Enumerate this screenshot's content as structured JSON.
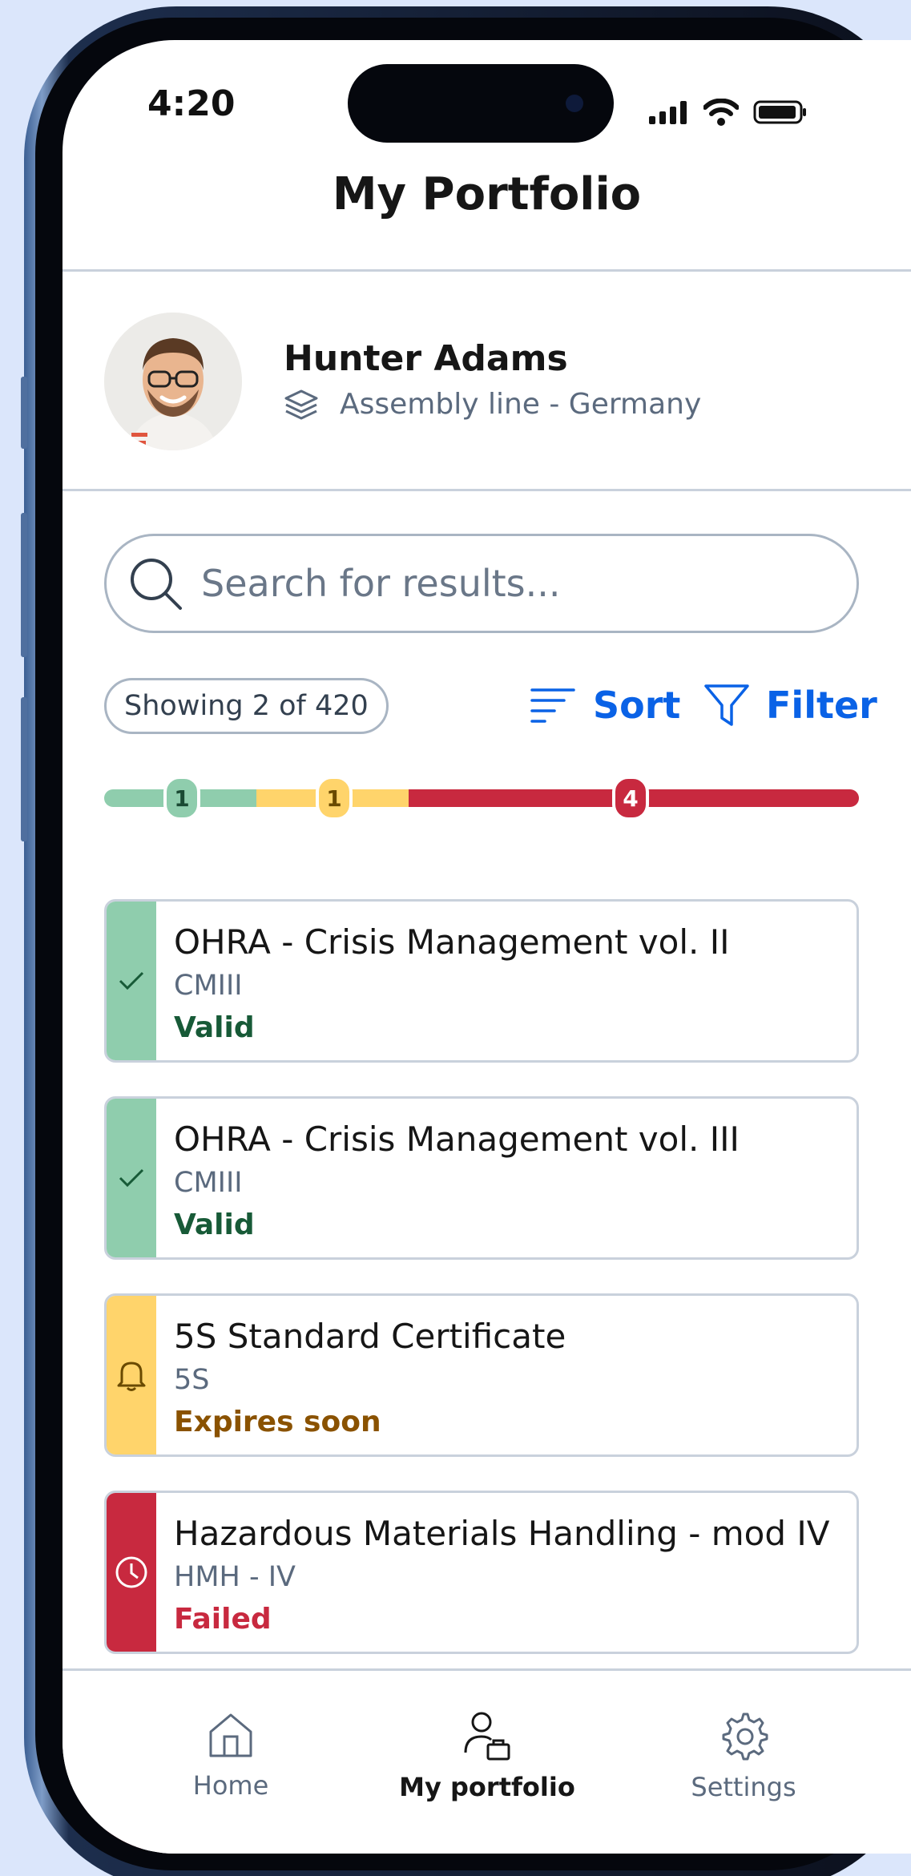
{
  "status_bar": {
    "time": "4:20"
  },
  "header": {
    "title": "My Portfolio"
  },
  "profile": {
    "name": "Hunter Adams",
    "org": "Assembly line - Germany"
  },
  "search": {
    "placeholder": "Search for results..."
  },
  "toolbar": {
    "showing": "Showing 2 of 420",
    "sort_label": "Sort",
    "filter_label": "Filter"
  },
  "summary_bar": {
    "valid_count": "1",
    "expiring_count": "1",
    "failed_count": "4"
  },
  "cards": [
    {
      "title": "OHRA - Crisis Management vol. II",
      "code": "CMIII",
      "status": "Valid",
      "icon": "check-icon"
    },
    {
      "title": "OHRA - Crisis Management vol. III",
      "code": "CMIII",
      "status": "Valid",
      "icon": "check-icon"
    },
    {
      "title": "5S Standard Certificate",
      "code": "5S",
      "status": "Expires soon",
      "icon": "bell-icon"
    },
    {
      "title": "Hazardous Materials Handling - mod IV",
      "code": "HMH - IV",
      "status": "Failed",
      "icon": "clock-icon"
    }
  ],
  "nav": {
    "home": "Home",
    "portfolio": "My portfolio",
    "settings": "Settings"
  },
  "colors": {
    "accent": "#0a62e6",
    "valid": "#8fcdad",
    "expiring": "#ffd46b",
    "failed": "#c8293f"
  }
}
